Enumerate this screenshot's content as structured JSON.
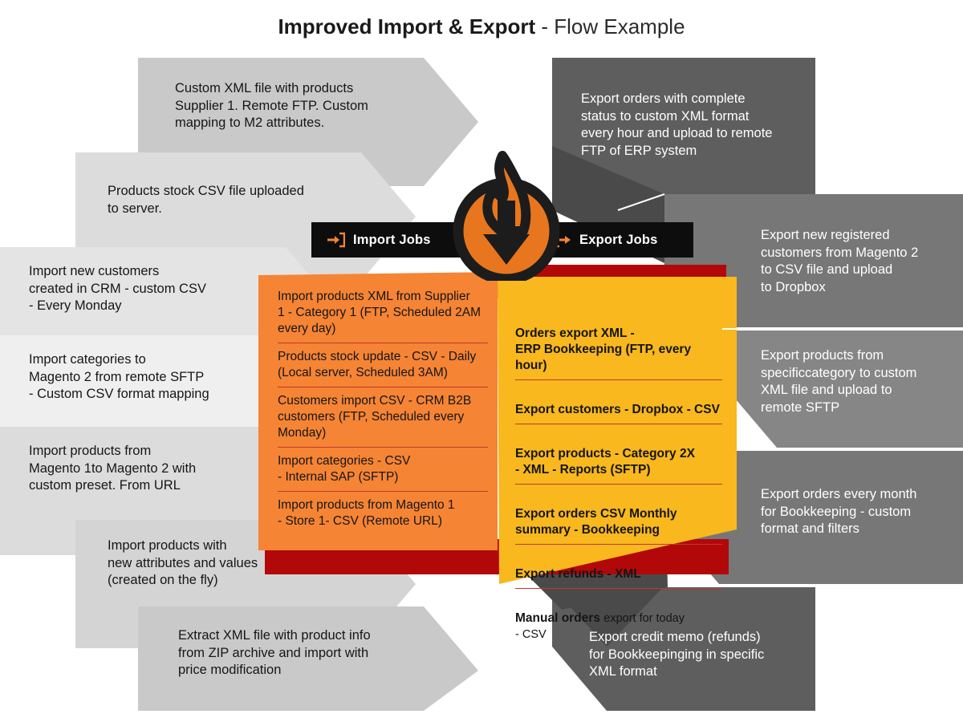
{
  "title": {
    "strong": "Improved Import & Export",
    "light": " - Flow Example"
  },
  "colors": {
    "import_panel": "#F58435",
    "export_panel": "#F8B81E",
    "shadow_red": "#B3080A",
    "left_card_light": "#EFEFEF",
    "left_card_mid": "#DCDCDC",
    "left_card_dark": "#C9C9C9",
    "right_card_light": "#868686",
    "right_card_mid": "#777777",
    "right_card_dark": "#5E5E5E",
    "tab_bar": "#0D0D0D",
    "divider": "#C0392B",
    "flame_orange": "#E8761E"
  },
  "tabs": {
    "import": {
      "label": "Import Jobs",
      "icon": "import-arrow-icon"
    },
    "export": {
      "label": "Export Jobs",
      "icon": "export-arrow-icon"
    }
  },
  "logo": {
    "icon": "firebear-flame-download-icon"
  },
  "import_sources": [
    {
      "id": "custom-xml-supplier",
      "text": "Custom XML file with products\nSupplier 1. Remote FTP. Custom\nmapping to M2 attributes."
    },
    {
      "id": "products-stock-csv",
      "text": "Products stock CSV file uploaded\nto server."
    },
    {
      "id": "new-customers-crm",
      "text": "Import new customers\ncreated in CRM - custom CSV\n- Every Monday"
    },
    {
      "id": "categories-sftp",
      "text": "Import categories to\nMagento 2 from remote SFTP\n- Custom CSV format mapping"
    },
    {
      "id": "products-m1-to-m2",
      "text": "Import products from\nMagento 1to Magento 2 with\ncustom preset. From URL"
    },
    {
      "id": "products-new-attributes",
      "text": "Import products with\nnew attributes and values\n(created on the fly)"
    },
    {
      "id": "extract-xml-zip",
      "text": "Extract XML file with product info\nfrom ZIP archive and import with\nprice modification"
    }
  ],
  "export_targets": [
    {
      "id": "orders-complete-status",
      "text": "Export orders with complete\nstatus to custom XML format\nevery hour and upload to remote\nFTP of ERP system"
    },
    {
      "id": "new-registered-customers",
      "text": "Export new registered\ncustomers from Magento 2\nto CSV file and upload\nto Dropbox"
    },
    {
      "id": "products-specific-category",
      "text": "Export products from\nspecificcategory to custom\nXML file and upload to\nremote SFTP"
    },
    {
      "id": "orders-every-month",
      "text": "Export orders every month\nfor Bookkeeping - custom\nformat and filters"
    },
    {
      "id": "credit-memo-refunds",
      "text": "Export credit memo (refunds)\nfor Bookkeepinging in specific\nXML format"
    }
  ],
  "import_jobs": [
    {
      "id": "import-products-xml-supplier1",
      "text": "Import products XML from Supplier\n1 - Category 1 (FTP, Scheduled 2AM\nevery day)"
    },
    {
      "id": "products-stock-update",
      "text": "Products stock update - CSV - Daily\n(Local server, Scheduled 3AM)"
    },
    {
      "id": "customers-import-csv",
      "text": "Customers import CSV - CRM B2B\ncustomers (FTP, Scheduled every\nMonday)"
    },
    {
      "id": "import-categories-csv",
      "text": "Import categories - CSV\n- Internal SAP (SFTP)"
    },
    {
      "id": "import-products-magento1",
      "text": "Import products from Magento 1\n- Store 1- CSV (Remote URL)"
    }
  ],
  "export_jobs": [
    {
      "id": "orders-export-xml-erp",
      "bold": "Orders export XML -\nERP Bookkeeping (FTP, every hour)",
      "reg": ""
    },
    {
      "id": "export-customers-dropbox",
      "bold": "Export customers - Dropbox - CSV",
      "reg": ""
    },
    {
      "id": "export-products-category2x",
      "bold": "Export products - Category 2X\n- XML - Reports (SFTP)",
      "reg": ""
    },
    {
      "id": "export-orders-csv-monthly",
      "bold": "Export orders CSV Monthly\nsummary - Bookkeeping",
      "reg": ""
    },
    {
      "id": "export-refunds-xml",
      "bold": "Export refunds - XML",
      "reg": ""
    },
    {
      "id": "manual-orders-export",
      "bold": "Manual orders ",
      "reg": "export for today\n- CSV"
    }
  ]
}
